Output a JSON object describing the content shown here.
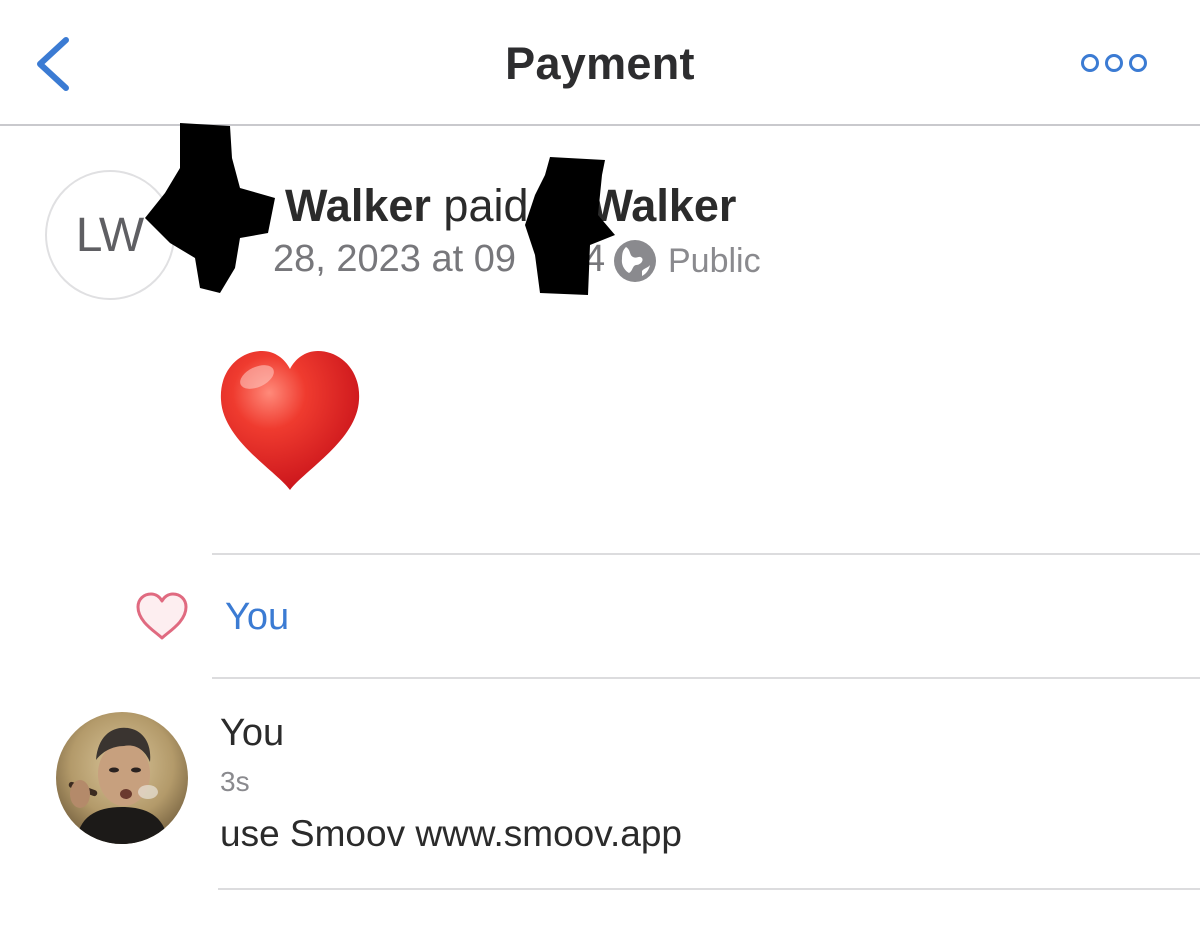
{
  "header": {
    "title": "Payment",
    "back_icon": "chevron-left-icon",
    "more_icon": "more-dots-icon",
    "accent_color": "#3b7bd3"
  },
  "story": {
    "avatar_initials": "LW",
    "payer_surname": "Walker",
    "verb": "paid",
    "payee_surname": "Walker",
    "date_fragment": "28, 2023 at 09",
    "time_fragment": "4",
    "audience_icon": "globe-icon",
    "audience": "Public",
    "note_emoji": "red-heart-icon"
  },
  "likes": {
    "icon": "heart-outline-icon",
    "likers": "You"
  },
  "comment": {
    "author": "You",
    "time": "3s",
    "text": "use Smoov www.smoov.app"
  }
}
